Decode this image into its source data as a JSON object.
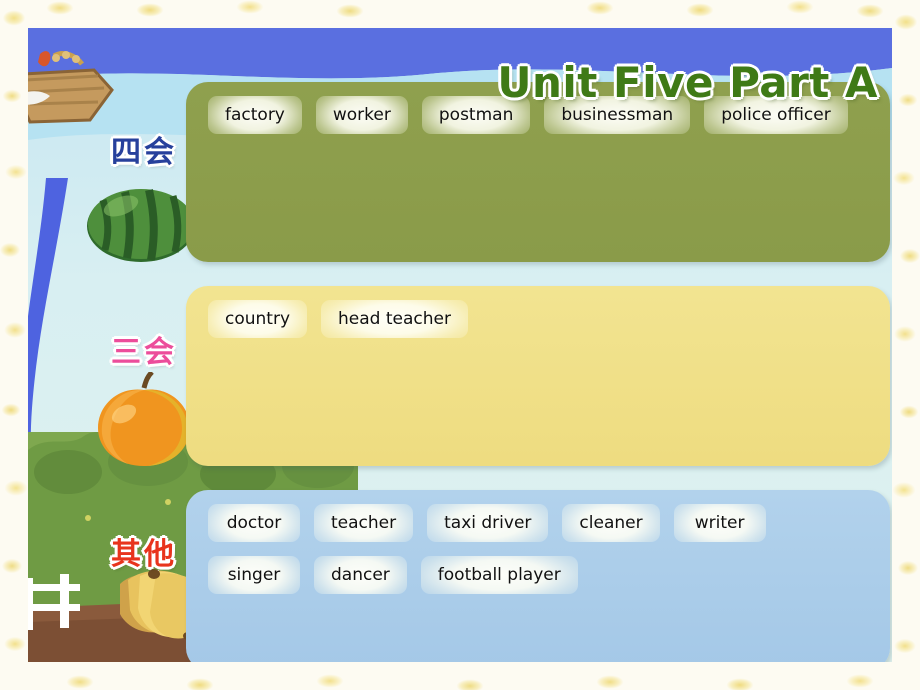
{
  "slide": {
    "title": "Unit Five Part A",
    "title_color": "#3f7a16",
    "background_colors": {
      "sky": "#c6e6f2",
      "wave_dark_blue": "#5a6fe0",
      "wave_light_blue": "#b6e2f2",
      "ribbon_blue": "#4e63e0",
      "meadow_green": "#6f9b44",
      "border_cream": "#fdfbf2"
    }
  },
  "categories": [
    {
      "id": "si-hui",
      "label": "四会",
      "label_color": "#27409c",
      "fruit_icon": "watermelon-icon",
      "panel_color": "#8a9b49",
      "rows": [
        [
          "factory",
          "worker",
          "postman",
          "businessman",
          "police officer"
        ]
      ]
    },
    {
      "id": "san-hui",
      "label": "三会",
      "label_color": "#ec4d9b",
      "fruit_icon": "apple-icon",
      "panel_color": "#eedc80",
      "rows": [
        [
          "country",
          "head teacher"
        ]
      ]
    },
    {
      "id": "qi-ta",
      "label": "其他",
      "label_color": "#e8341d",
      "fruit_icon": "banana-icon",
      "panel_color": "#a4c8e7",
      "rows": [
        [
          "doctor",
          "teacher",
          "taxi driver",
          "cleaner",
          "writer"
        ],
        [
          "singer",
          "dancer",
          "football player"
        ]
      ]
    }
  ],
  "decorations": {
    "basket_icon": "wooden-basket-icon",
    "fence_icon": "white-picket-fence-icon",
    "border_icon": "yellow-blossom-border-icon"
  }
}
